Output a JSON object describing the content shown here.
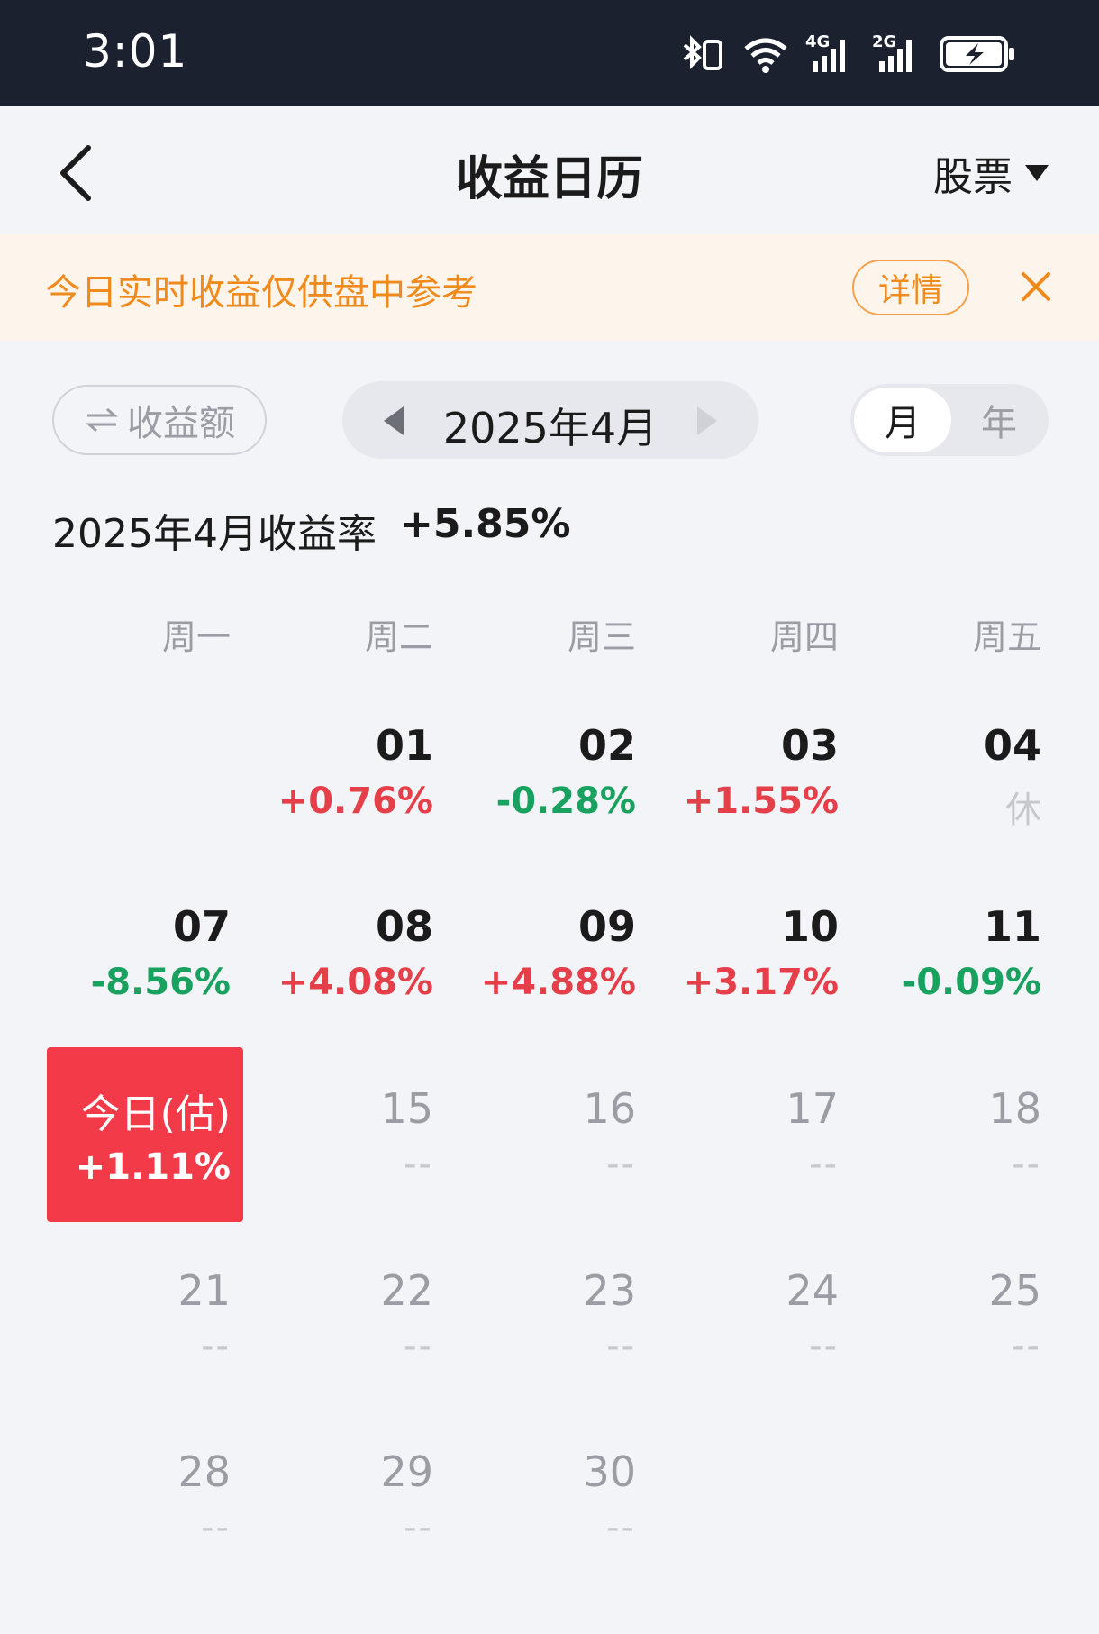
{
  "status_bar": {
    "time": "3:01",
    "network_1": "4G",
    "network_2": "2G"
  },
  "header": {
    "title": "收益日历",
    "selector_label": "股票"
  },
  "notice": {
    "text": "今日实时收益仅供盘中参考",
    "detail_label": "详情"
  },
  "controls": {
    "metric_label": "收益额",
    "month_label": "2025年4月",
    "period_month": "月",
    "period_year": "年"
  },
  "summary": {
    "label": "2025年4月收益率",
    "value": "+5.85%"
  },
  "weekdays": [
    "周一",
    "周二",
    "周三",
    "周四",
    "周五"
  ],
  "days": {
    "d01": {
      "num": "01",
      "ret": "+0.76%"
    },
    "d02": {
      "num": "02",
      "ret": "-0.28%"
    },
    "d03": {
      "num": "03",
      "ret": "+1.55%"
    },
    "d04": {
      "num": "04",
      "ret": "休"
    },
    "d07": {
      "num": "07",
      "ret": "-8.56%"
    },
    "d08": {
      "num": "08",
      "ret": "+4.08%"
    },
    "d09": {
      "num": "09",
      "ret": "+4.88%"
    },
    "d10": {
      "num": "10",
      "ret": "+3.17%"
    },
    "d11": {
      "num": "11",
      "ret": "-0.09%"
    },
    "d15": {
      "num": "15",
      "ret": "--"
    },
    "d16": {
      "num": "16",
      "ret": "--"
    },
    "d17": {
      "num": "17",
      "ret": "--"
    },
    "d18": {
      "num": "18",
      "ret": "--"
    },
    "d21": {
      "num": "21",
      "ret": "--"
    },
    "d22": {
      "num": "22",
      "ret": "--"
    },
    "d23": {
      "num": "23",
      "ret": "--"
    },
    "d24": {
      "num": "24",
      "ret": "--"
    },
    "d25": {
      "num": "25",
      "ret": "--"
    },
    "d28": {
      "num": "28",
      "ret": "--"
    },
    "d29": {
      "num": "29",
      "ret": "--"
    },
    "d30": {
      "num": "30",
      "ret": "--"
    }
  },
  "today": {
    "label": "今日(估)",
    "ret": "+1.11%"
  },
  "colors": {
    "up": "#e53f4a",
    "down": "#19a15f",
    "today_bg": "#f33a48",
    "notice": "#f08a1c"
  }
}
